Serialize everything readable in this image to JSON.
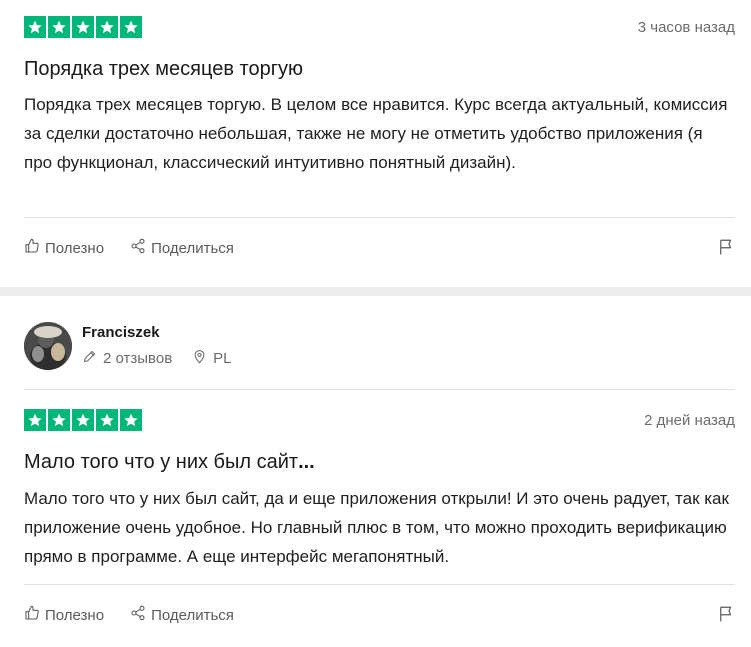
{
  "reviews": [
    {
      "rating": 5,
      "date": "3 часов назад",
      "title": "Порядка трех месяцев торгую",
      "body": "Порядка трех месяцев торгую. В целом все нравится. Курс всегда актуальный, комиссия за сделки достаточно небольшая, также не могу не отметить удобство приложения (я про функционал, классический интуитивно понятный дизайн).",
      "actions": {
        "helpful": "Полезно",
        "share": "Поделиться"
      }
    },
    {
      "reviewer": {
        "name": "Franciszek",
        "reviews_count": "2 отзывов",
        "country": "PL"
      },
      "rating": 5,
      "date": "2 дней назад",
      "title": "Мало того что у них был сайт",
      "title_suffix": "...",
      "body": "Мало того что у них был сайт, да и еще приложения открыли! И это очень радует, так как приложение очень удобное. Но главный плюс в том, что можно проходить верификацию прямо в программе. А еще интерфейс мегапонятный.",
      "actions": {
        "helpful": "Полезно",
        "share": "Поделиться"
      }
    }
  ],
  "colors": {
    "star_bg": "#00b67a",
    "separator": "#ededed"
  },
  "icons": {
    "star": "star-icon",
    "helpful": "thumbs-up-icon",
    "share": "share-icon",
    "flag": "flag-icon",
    "pencil": "pencil-icon",
    "location": "location-pin-icon"
  }
}
